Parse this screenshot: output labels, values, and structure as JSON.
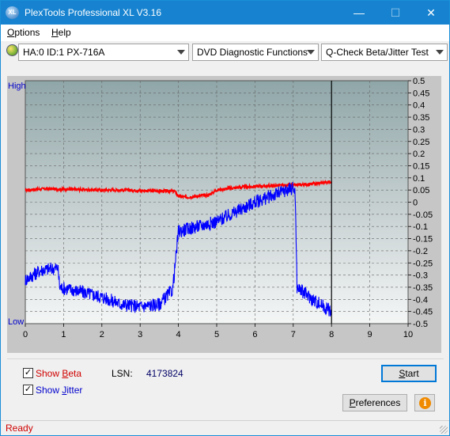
{
  "window": {
    "title": "PlexTools Professional XL V3.16",
    "icon_text": "XL",
    "controls": {
      "minimize": "—",
      "maximize": "☐",
      "close": "✕"
    }
  },
  "menu": {
    "options_first": "O",
    "options_rest": "ptions",
    "help_first": "H",
    "help_rest": "elp"
  },
  "toolbar": {
    "drive": "HA:0 ID:1  PX-716A",
    "function": "DVD Diagnostic Functions",
    "test": "Q-Check Beta/Jitter Test"
  },
  "chart_data": {
    "type": "line",
    "xlim": [
      0,
      10
    ],
    "ylim": [
      -0.5,
      0.5
    ],
    "x_ticks": [
      "0",
      "1",
      "2",
      "3",
      "4",
      "5",
      "6",
      "7",
      "8",
      "9",
      "10"
    ],
    "y_ticks": [
      "0.5",
      "0.45",
      "0.4",
      "0.35",
      "0.3",
      "0.25",
      "0.2",
      "0.15",
      "0.1",
      "0.05",
      "0",
      "-0.05",
      "-0.1",
      "-0.15",
      "-0.2",
      "-0.25",
      "-0.3",
      "-0.35",
      "-0.4",
      "-0.45",
      "-0.5"
    ],
    "high_label": "High",
    "low_label": "Low",
    "colors": {
      "beta": "#ff0000",
      "jitter": "#0000ff",
      "marker": "#000000"
    },
    "cursor_x": 8.0,
    "series": [
      {
        "color": "#ff0000",
        "x": [
          0,
          0.5,
          1,
          1.5,
          2,
          2.5,
          3,
          3.5,
          3.9,
          4.0,
          4.2,
          4.5,
          4.8,
          5.0,
          5.5,
          6.0,
          6.5,
          7.0,
          7.5,
          8.0
        ],
        "y": [
          0.05,
          0.055,
          0.053,
          0.052,
          0.05,
          0.05,
          0.048,
          0.046,
          0.045,
          0.025,
          0.02,
          0.025,
          0.03,
          0.05,
          0.06,
          0.065,
          0.068,
          0.07,
          0.075,
          0.085
        ]
      },
      {
        "color": "#0000ff",
        "x": [
          0,
          0.4,
          0.85,
          0.9,
          1.5,
          2.0,
          2.5,
          3.0,
          3.5,
          3.85,
          3.95,
          4.0,
          4.5,
          5.0,
          5.5,
          6.0,
          6.5,
          7.0,
          7.05,
          7.1,
          7.5,
          8.0
        ],
        "y": [
          -0.32,
          -0.28,
          -0.27,
          -0.35,
          -0.37,
          -0.39,
          -0.42,
          -0.43,
          -0.42,
          -0.36,
          -0.2,
          -0.12,
          -0.1,
          -0.08,
          -0.04,
          0.0,
          0.03,
          0.06,
          0.04,
          -0.35,
          -0.4,
          -0.45
        ]
      }
    ]
  },
  "bottom": {
    "show_beta_first": "Show ",
    "show_beta_u": "B",
    "show_beta_rest": "eta",
    "show_jitter_first": "Show ",
    "show_jitter_u": "J",
    "show_jitter_rest": "itter",
    "beta_checked": "✓",
    "jitter_checked": "✓",
    "lsn_label": "LSN:",
    "lsn_value": "4173824",
    "start_u": "S",
    "start_rest": "tart",
    "prefs_u": "P",
    "prefs_rest": "references",
    "info_glyph": "i"
  },
  "status": {
    "text": "Ready"
  }
}
